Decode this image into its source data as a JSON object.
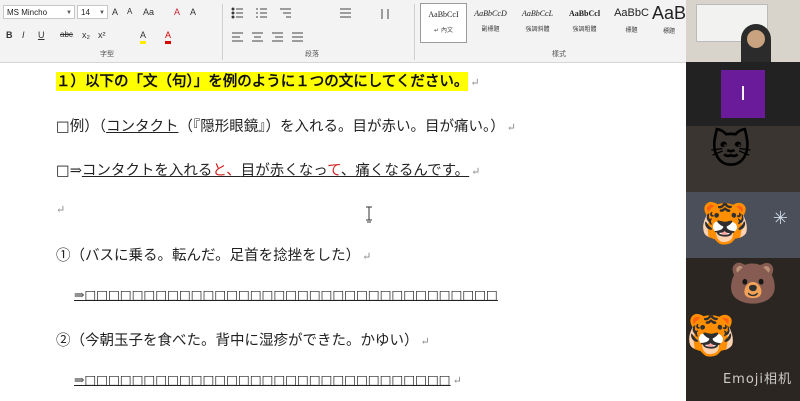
{
  "ribbon": {
    "font_name": "MS Mincho",
    "font_size": "14",
    "buttons_row1": [
      "A",
      "A",
      "Aa",
      "A",
      "A"
    ],
    "buttons_row2": [
      "B",
      "I",
      "U",
      "abc",
      "x₂",
      "x²",
      "A",
      "A"
    ],
    "group_font": "字型",
    "group_paragraph": "段落",
    "group_styles": "樣式",
    "styles": [
      {
        "sample": "AaBbCcI",
        "name": "↵ 內文",
        "selected": true
      },
      {
        "sample": "AaBbCcD",
        "name": "副標題"
      },
      {
        "sample": "AaBbCcL",
        "name": "強調斜體"
      },
      {
        "sample": "AaBbCcl",
        "name": "強調粗體"
      },
      {
        "sample": "AaBbC",
        "name": "標題"
      },
      {
        "sample": "AaB",
        "name": "標題"
      }
    ]
  },
  "document": {
    "heading": "１）以下の「文（句）」を例のように１つの文にしてください。",
    "example_prefix": "□例）（",
    "example_underlined": "コンタクト",
    "example_rest": "（『隠形眼鏡』）を入れる。目が赤い。目が痛い。）",
    "answer_prefix": "□⇒",
    "answer_part1": "コンタクトを入れる",
    "answer_red1": "と、",
    "answer_part2": "目が赤くなっ",
    "answer_red2": "て",
    "answer_part3": "、痛くなるんです。",
    "q1": "①（バスに乗る。転んだ。足首を捻挫をした）",
    "q1_answer": "⇒□□□□□□□□□□□□□□□□□□□□□□□□□□□□□□□□□□□",
    "q2": "②（今朝玉子を食べた。背中に湿疹ができた。かゆい）",
    "q2_answer": "⇒□□□□□□□□□□□□□□□□□□□□□□□□□□□□□□□",
    "para_mark": "↵"
  },
  "video_panel": {
    "participant_initial": "I",
    "participant_tile_color": "#6a1b9a",
    "emojis": [
      "cat-face",
      "tiger-face",
      "bear-face",
      "tiger-face"
    ],
    "watermark": "Emoji相机"
  },
  "colors": {
    "highlight": "#ffff00",
    "red_text": "#d02020"
  }
}
